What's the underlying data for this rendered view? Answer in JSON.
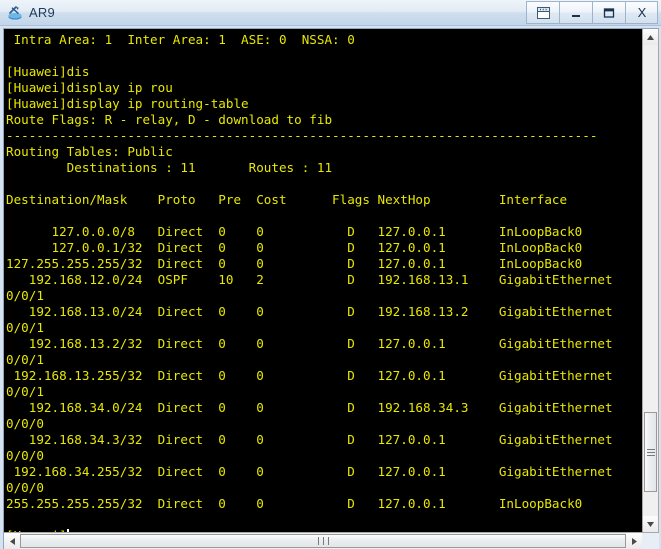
{
  "window": {
    "title": "AR9",
    "icon": "router-device-icon",
    "buttons": [
      {
        "name": "restore-window-button",
        "glyph": "restore"
      },
      {
        "name": "minimize-button",
        "glyph": "minimize"
      },
      {
        "name": "maximize-button",
        "glyph": "maximize"
      },
      {
        "name": "close-button",
        "glyph": "X"
      }
    ]
  },
  "console": {
    "foreground_color": "#e8e800",
    "background_color": "#000000",
    "cursor_color": "#ffffff",
    "lines": [
      " Intra Area: 1  Inter Area: 1  ASE: 0  NSSA: 0",
      "",
      "[Huawei]dis",
      "[Huawei]display ip rou",
      "[Huawei]display ip routing-table",
      "Route Flags: R - relay, D - download to fib",
      "------------------------------------------------------------------------------",
      "Routing Tables: Public",
      "        Destinations : 11       Routes : 11",
      "",
      "Destination/Mask    Proto   Pre  Cost      Flags NextHop         Interface",
      "",
      "      127.0.0.0/8   Direct  0    0           D   127.0.0.1       InLoopBack0",
      "      127.0.0.1/32  Direct  0    0           D   127.0.0.1       InLoopBack0",
      "127.255.255.255/32  Direct  0    0           D   127.0.0.1       InLoopBack0",
      "   192.168.12.0/24  OSPF    10   2           D   192.168.13.1    GigabitEthernet",
      "0/0/1",
      "   192.168.13.0/24  Direct  0    0           D   192.168.13.2    GigabitEthernet",
      "0/0/1",
      "   192.168.13.2/32  Direct  0    0           D   127.0.0.1       GigabitEthernet",
      "0/0/1",
      " 192.168.13.255/32  Direct  0    0           D   127.0.0.1       GigabitEthernet",
      "0/0/1",
      "   192.168.34.0/24  Direct  0    0           D   192.168.34.3    GigabitEthernet",
      "0/0/0",
      "   192.168.34.3/32  Direct  0    0           D   127.0.0.1       GigabitEthernet",
      "0/0/0",
      " 192.168.34.255/32  Direct  0    0           D   127.0.0.1       GigabitEthernet",
      "0/0/0",
      "255.255.255.255/32  Direct  0    0           D   127.0.0.1       InLoopBack0",
      ""
    ],
    "prompt": "[Huawei]"
  },
  "ospf_summary": {
    "intra_area_label": "Intra Area",
    "intra_area": "1",
    "inter_area_label": "Inter Area",
    "inter_area": "1",
    "ase_label": "ASE",
    "ase": "0",
    "nssa_label": "NSSA",
    "nssa": "0"
  },
  "routing_table": {
    "route_flags": "Route Flags: R - relay, D - download to fib",
    "tables_label": "Routing Tables: Public",
    "destinations_label": "Destinations",
    "destinations": "11",
    "routes_label": "Routes",
    "routes": "11",
    "columns": [
      "Destination/Mask",
      "Proto",
      "Pre",
      "Cost",
      "Flags",
      "NextHop",
      "Interface"
    ],
    "rows": [
      {
        "destination": "127.0.0.0/8",
        "proto": "Direct",
        "pre": "0",
        "cost": "0",
        "flags": "D",
        "nexthop": "127.0.0.1",
        "interface": "InLoopBack0"
      },
      {
        "destination": "127.0.0.1/32",
        "proto": "Direct",
        "pre": "0",
        "cost": "0",
        "flags": "D",
        "nexthop": "127.0.0.1",
        "interface": "InLoopBack0"
      },
      {
        "destination": "127.255.255.255/32",
        "proto": "Direct",
        "pre": "0",
        "cost": "0",
        "flags": "D",
        "nexthop": "127.0.0.1",
        "interface": "InLoopBack0"
      },
      {
        "destination": "192.168.12.0/24",
        "proto": "OSPF",
        "pre": "10",
        "cost": "2",
        "flags": "D",
        "nexthop": "192.168.13.1",
        "interface": "GigabitEthernet0/0/1"
      },
      {
        "destination": "192.168.13.0/24",
        "proto": "Direct",
        "pre": "0",
        "cost": "0",
        "flags": "D",
        "nexthop": "192.168.13.2",
        "interface": "GigabitEthernet0/0/1"
      },
      {
        "destination": "192.168.13.2/32",
        "proto": "Direct",
        "pre": "0",
        "cost": "0",
        "flags": "D",
        "nexthop": "127.0.0.1",
        "interface": "GigabitEthernet0/0/1"
      },
      {
        "destination": "192.168.13.255/32",
        "proto": "Direct",
        "pre": "0",
        "cost": "0",
        "flags": "D",
        "nexthop": "127.0.0.1",
        "interface": "GigabitEthernet0/0/1"
      },
      {
        "destination": "192.168.34.0/24",
        "proto": "Direct",
        "pre": "0",
        "cost": "0",
        "flags": "D",
        "nexthop": "192.168.34.3",
        "interface": "GigabitEthernet0/0/0"
      },
      {
        "destination": "192.168.34.3/32",
        "proto": "Direct",
        "pre": "0",
        "cost": "0",
        "flags": "D",
        "nexthop": "127.0.0.1",
        "interface": "GigabitEthernet0/0/0"
      },
      {
        "destination": "192.168.34.255/32",
        "proto": "Direct",
        "pre": "0",
        "cost": "0",
        "flags": "D",
        "nexthop": "127.0.0.1",
        "interface": "GigabitEthernet0/0/0"
      },
      {
        "destination": "255.255.255.255/32",
        "proto": "Direct",
        "pre": "0",
        "cost": "0",
        "flags": "D",
        "nexthop": "127.0.0.1",
        "interface": "InLoopBack0"
      }
    ],
    "commands": [
      "[Huawei]dis",
      "[Huawei]display ip rou",
      "[Huawei]display ip routing-table"
    ]
  },
  "scrollbars": {
    "vertical": {
      "up_arrow": "▲",
      "down_arrow": "▼",
      "thumb_top_pct": 78,
      "thumb_height_pct": 17
    },
    "horizontal": {
      "left_arrow": "◀",
      "right_arrow": "▶"
    }
  }
}
